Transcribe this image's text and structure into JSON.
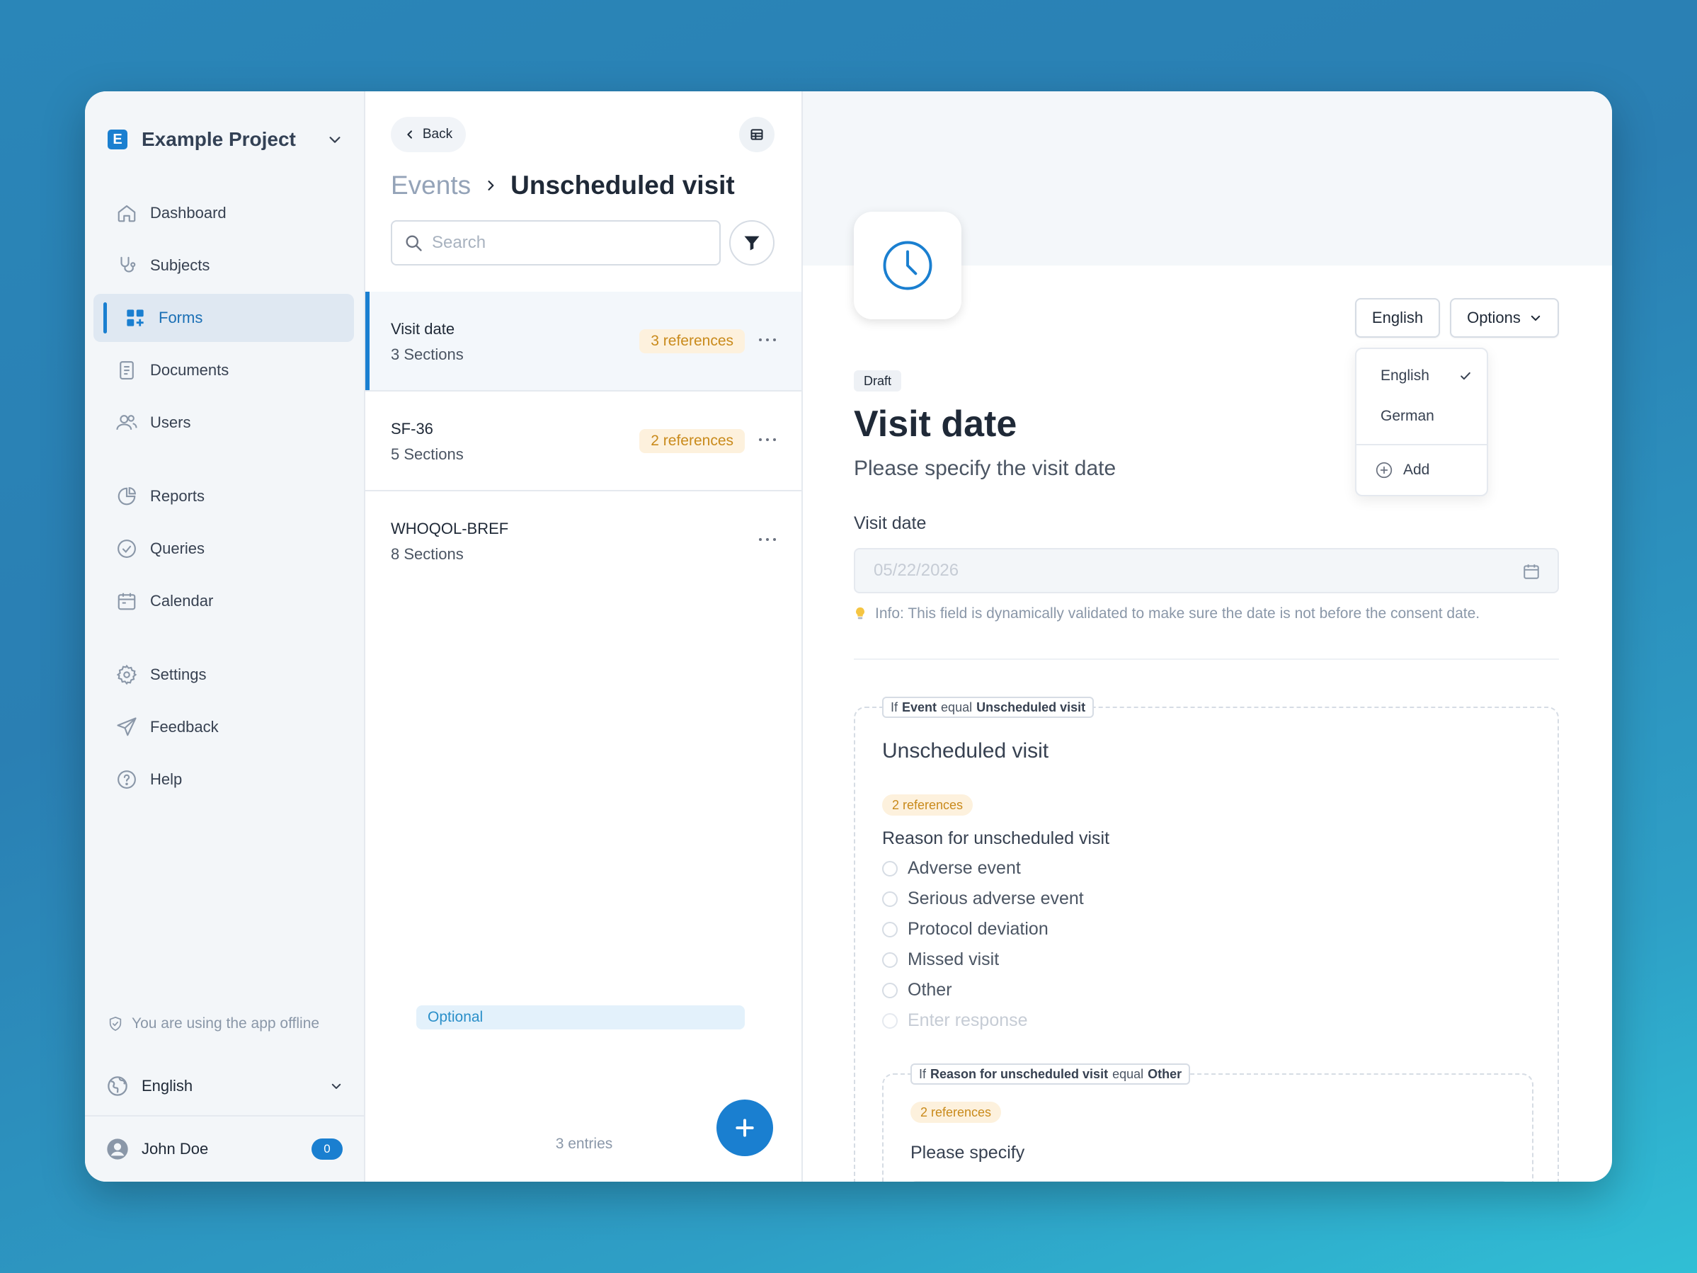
{
  "project": {
    "logo_letter": "E",
    "name": "Example Project"
  },
  "sidebar": {
    "items": [
      {
        "label": "Dashboard",
        "icon": "home-icon"
      },
      {
        "label": "Subjects",
        "icon": "stethoscope-icon"
      },
      {
        "label": "Forms",
        "icon": "forms-grid-icon",
        "active": true
      },
      {
        "label": "Documents",
        "icon": "document-icon"
      },
      {
        "label": "Users",
        "icon": "users-icon"
      },
      {
        "label": "Reports",
        "icon": "pie-chart-icon"
      },
      {
        "label": "Queries",
        "icon": "check-circle-icon"
      },
      {
        "label": "Calendar",
        "icon": "calendar-icon"
      },
      {
        "label": "Settings",
        "icon": "gear-icon"
      },
      {
        "label": "Feedback",
        "icon": "send-icon"
      },
      {
        "label": "Help",
        "icon": "help-icon"
      }
    ],
    "offline_text": "You are using the app offline",
    "language": "English",
    "user": {
      "name": "John Doe",
      "count": "0"
    }
  },
  "middle": {
    "back_label": "Back",
    "breadcrumb": {
      "parent": "Events",
      "current": "Unscheduled visit"
    },
    "search": {
      "placeholder": "Search",
      "value": ""
    },
    "rows": [
      {
        "title": "Visit date",
        "subtitle": "3 Sections",
        "badge": "3 references",
        "badge_type": "warn"
      },
      {
        "title": "SF-36",
        "subtitle": "5 Sections",
        "badge": "2 references",
        "badge_type": "warn"
      },
      {
        "title": "WHOQOL-BREF",
        "subtitle": "8 Sections",
        "badge": "Optional",
        "badge_type": "info"
      }
    ],
    "entries_text": "3 entries"
  },
  "detail": {
    "language_button": "English",
    "options_button": "Options",
    "dropdown": {
      "items": [
        "English",
        "German"
      ],
      "selected": "English",
      "add_label": "Add"
    },
    "status": "Draft",
    "title": "Visit date",
    "subtitle": "Please specify the visit date",
    "field_label": "Visit date",
    "date_placeholder": "05/22/2026",
    "info_text": "Info: This field is dynamically validated to make sure the date is not before the consent date.",
    "condition1": {
      "prefix": "If",
      "field": "Event",
      "op": "equal",
      "value": "Unscheduled visit"
    },
    "section_title": "Unscheduled visit",
    "section_refs": "2 references",
    "question": "Reason for unscheduled visit",
    "options": [
      "Adverse event",
      "Serious adverse event",
      "Protocol deviation",
      "Missed visit",
      "Other"
    ],
    "response_placeholder": "Enter response",
    "condition2": {
      "prefix": "If",
      "field": "Reason for unscheduled visit",
      "op": "equal",
      "value": "Other"
    },
    "nested_refs": "2 references",
    "nested_question": "Please specify"
  },
  "colors": {
    "accent": "#1a7fd0",
    "warn_bg": "#fdf1dd",
    "warn_text": "#c98a1b",
    "info_bg": "#e3f1fb",
    "info_text": "#2a8fc9"
  }
}
